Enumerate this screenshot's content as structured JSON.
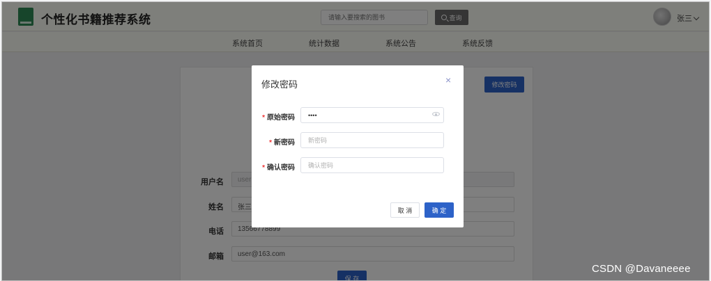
{
  "header": {
    "app_title": "个性化书籍推荐系统",
    "search_placeholder": "请输入要搜索的图书",
    "search_label": "查询",
    "user_name": "张三"
  },
  "nav": {
    "items": [
      {
        "label": "系统首页"
      },
      {
        "label": "统计数据"
      },
      {
        "label": "系统公告"
      },
      {
        "label": "系统反馈"
      }
    ]
  },
  "profile": {
    "change_password_label": "修改密码",
    "fields": [
      {
        "label": "用户名",
        "value": "user"
      },
      {
        "label": "姓名",
        "value": "张三"
      },
      {
        "label": "电话",
        "value": "13566778899"
      },
      {
        "label": "邮箱",
        "value": "user@163.com"
      }
    ],
    "save_label": "保 存"
  },
  "modal": {
    "title": "修改密码",
    "close": "×",
    "fields": [
      {
        "label": "原始密码",
        "required": "*",
        "value": "••••",
        "placeholder": ""
      },
      {
        "label": "新密码",
        "required": "*",
        "value": "",
        "placeholder": "新密码"
      },
      {
        "label": "确认密码",
        "required": "*",
        "value": "",
        "placeholder": "确认密码"
      }
    ],
    "cancel_label": "取 消",
    "confirm_label": "确 定"
  },
  "watermark": "CSDN @Davaneeee",
  "colors": {
    "primary": "#2d62c8",
    "required": "#ee3333",
    "header_bg": "#fdfef6",
    "logo": "#2e8b57"
  }
}
